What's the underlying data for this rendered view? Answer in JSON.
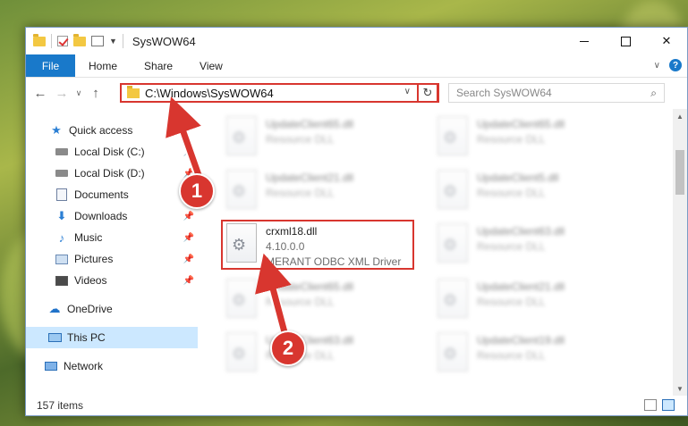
{
  "window": {
    "title": "SysWOW64",
    "controls": {
      "minimize": "",
      "maximize": "",
      "close": "✕"
    }
  },
  "ribbon": {
    "tabs": [
      "File",
      "Home",
      "Share",
      "View"
    ]
  },
  "address": {
    "path": "C:\\Windows\\SysWOW64",
    "search_placeholder": "Search SysWOW64"
  },
  "sidebar": {
    "items": [
      {
        "label": "Quick access",
        "icon": "star-icon",
        "pinned": false
      },
      {
        "label": "Local Disk (C:)",
        "icon": "drive-icon",
        "pinned": true
      },
      {
        "label": "Local Disk (D:)",
        "icon": "drive-icon",
        "pinned": true
      },
      {
        "label": "Documents",
        "icon": "documents-icon",
        "pinned": true
      },
      {
        "label": "Downloads",
        "icon": "downloads-icon",
        "pinned": true
      },
      {
        "label": "Music",
        "icon": "music-icon",
        "pinned": true
      },
      {
        "label": "Pictures",
        "icon": "pictures-icon",
        "pinned": true
      },
      {
        "label": "Videos",
        "icon": "videos-icon",
        "pinned": true
      },
      {
        "label": "OneDrive",
        "icon": "onedrive-icon",
        "pinned": false
      },
      {
        "label": "This PC",
        "icon": "this-pc-icon",
        "pinned": false
      },
      {
        "label": "Network",
        "icon": "network-icon",
        "pinned": false
      }
    ]
  },
  "files": {
    "left": [
      {
        "name": "UpdateClient65.dll",
        "meta": "Resource DLL"
      },
      {
        "name": "UpdateClient21.dll",
        "meta": "Resource DLL"
      },
      {
        "name": "crxml18.dll",
        "version": "4.10.0.0",
        "description": "MERANT ODBC XML Driver"
      },
      {
        "name": "UpdateClient65.dll",
        "meta": "Resource DLL"
      },
      {
        "name": "UpdateClient63.dll",
        "meta": "Resource DLL"
      }
    ],
    "right": [
      {
        "name": "UpdateClient65.dll",
        "meta": "Resource DLL"
      },
      {
        "name": "UpdateClient5.dll",
        "meta": "Resource DLL"
      },
      {
        "name": "UpdateClient63.dll",
        "meta": "Resource DLL"
      },
      {
        "name": "UpdateClient21.dll",
        "meta": "Resource DLL"
      },
      {
        "name": "UpdateClient19.dll",
        "meta": "Resource DLL"
      }
    ]
  },
  "status": {
    "item_count": "157 items"
  },
  "annotations": {
    "step1": "1",
    "step2": "2"
  },
  "colors": {
    "accent": "#1979ca",
    "highlight": "#d8362f",
    "selected": "#cce8ff"
  }
}
